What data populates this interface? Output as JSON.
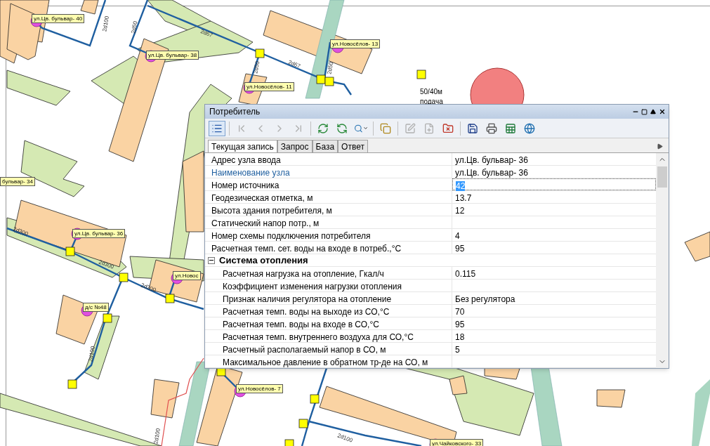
{
  "map": {
    "node_labels": [
      {
        "text": "ул.Цв. бульвар- 40"
      },
      {
        "text": "ул.Цв. бульвар- 38"
      },
      {
        "text": "ул.Новосёлов- 13"
      },
      {
        "text": "ул.Новосёлов- 11"
      },
      {
        "text": "бульвар- 34"
      },
      {
        "text": "ул.Цв. бульвар- 36"
      },
      {
        "text": "ул.Новос"
      },
      {
        "text": "д/с №48"
      },
      {
        "text": "ул.Новосёлов- 7"
      },
      {
        "text": "ул.Чайковского- 33"
      }
    ],
    "pipe_labels": [
      {
        "text": "2d100"
      },
      {
        "text": "2d50"
      },
      {
        "text": "2d67"
      },
      {
        "text": "2d50"
      },
      {
        "text": "2d67"
      },
      {
        "text": "2d50"
      },
      {
        "text": "2d300"
      },
      {
        "text": "2d300"
      },
      {
        "text": "2d300"
      },
      {
        "text": "2d100"
      },
      {
        "text": "2d100"
      },
      {
        "text": "2d100"
      }
    ],
    "notes": [
      {
        "text": "50/40м"
      },
      {
        "text": "подача"
      }
    ]
  },
  "window": {
    "title": "Потребитель",
    "toolbar": [
      {
        "kind": "view",
        "disabled": false
      },
      {
        "kind": "first",
        "disabled": true
      },
      {
        "kind": "prev",
        "disabled": true
      },
      {
        "kind": "next",
        "disabled": true
      },
      {
        "kind": "last",
        "disabled": true
      },
      {
        "kind": "refresh",
        "disabled": false
      },
      {
        "kind": "reload",
        "disabled": false
      },
      {
        "kind": "find",
        "disabled": false
      },
      {
        "kind": "copy",
        "disabled": false
      },
      {
        "kind": "edit",
        "disabled": true
      },
      {
        "kind": "add",
        "disabled": true
      },
      {
        "kind": "delete",
        "disabled": false
      },
      {
        "kind": "save",
        "disabled": false
      },
      {
        "kind": "print",
        "disabled": false
      },
      {
        "kind": "excel",
        "disabled": false
      },
      {
        "kind": "web",
        "disabled": false
      }
    ],
    "tabs": [
      {
        "label": "Текущая запись",
        "selected": true
      },
      {
        "label": "Запрос",
        "selected": false
      },
      {
        "label": "База",
        "selected": false
      },
      {
        "label": "Ответ",
        "selected": false
      }
    ],
    "rows": [
      {
        "kind": "field",
        "label": "Адрес узла ввода",
        "value": "ул.Цв. бульвар- 36",
        "selected": false
      },
      {
        "kind": "link",
        "label": "Наименование узла",
        "value": "ул.Цв. бульвар- 36",
        "selected": false
      },
      {
        "kind": "field",
        "label": "Номер источника",
        "value": "42",
        "selected": true
      },
      {
        "kind": "field",
        "label": "Геодезическая отметка, м",
        "value": "13.7",
        "selected": false
      },
      {
        "kind": "field",
        "label": "Высота здания потребителя, м",
        "value": "12",
        "selected": false
      },
      {
        "kind": "field",
        "label": "Статический напор потр., м",
        "selected": false
      },
      {
        "kind": "field",
        "label": "Номер схемы подключения потребителя",
        "value": "4",
        "selected": false
      },
      {
        "kind": "field",
        "label": "Расчетная темп. сет. воды на входе в потреб.,°С",
        "value": "95",
        "selected": false
      },
      {
        "kind": "group",
        "label": "Система отопления",
        "expanded": true,
        "children": [
          {
            "kind": "field",
            "label": "Расчетная нагрузка на отопление, Гкал/ч",
            "value": "0.115",
            "selected": false
          },
          {
            "kind": "field",
            "label": "Коэффициент изменения нагрузки отопления",
            "selected": false
          },
          {
            "kind": "field",
            "label": "Признак наличия регулятора на отопление",
            "value": "Без регулятора",
            "selected": false
          },
          {
            "kind": "field",
            "label": "Расчетная темп. воды на выходе из СО,°С",
            "value": "70",
            "selected": false
          },
          {
            "kind": "field",
            "label": "Расчетная темп. воды на входе в СО,°С",
            "value": "95",
            "selected": false
          },
          {
            "kind": "field",
            "label": "Расчетная темп. внутреннего воздуха для СО,°С",
            "value": "18",
            "selected": false
          },
          {
            "kind": "field",
            "label": "Расчетный располагаемый напор в СО, м",
            "value": "5",
            "selected": false
          },
          {
            "kind": "field",
            "label": "Максимальное давление в обратном тр-де на СО, м",
            "selected": false
          }
        ]
      }
    ]
  }
}
